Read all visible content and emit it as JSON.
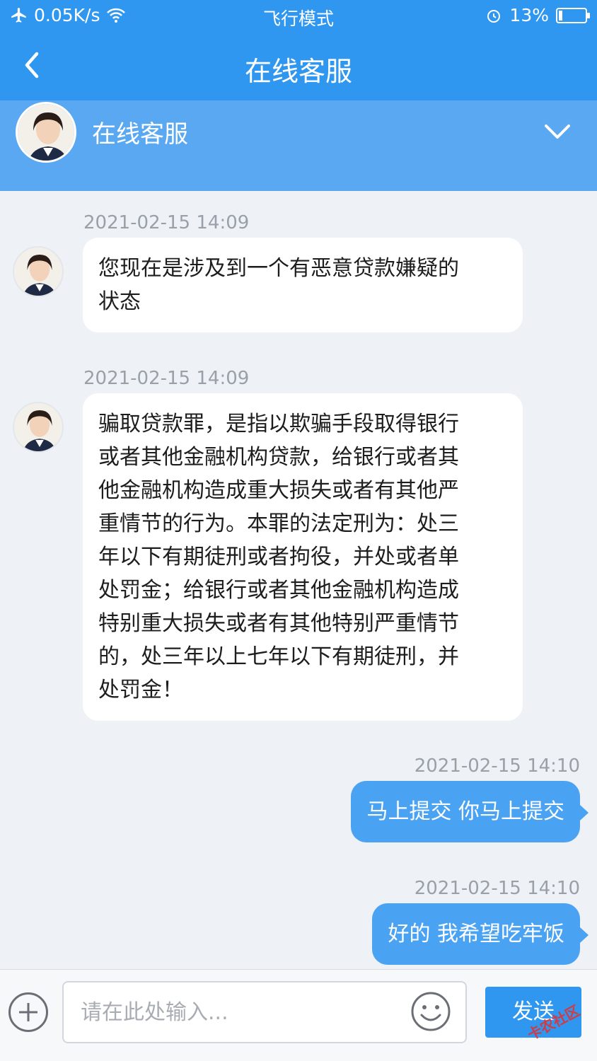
{
  "status_bar": {
    "speed": "0.05K/s",
    "mode": "飞行模式",
    "battery_text": "13%",
    "battery_level": 0.13,
    "icons": [
      "airplane-icon",
      "wifi-icon",
      "alarm-icon",
      "battery-charging-icon"
    ]
  },
  "nav": {
    "title": "在线客服",
    "back_icon": "chevron-left-icon"
  },
  "agent": {
    "name": "在线客服",
    "avatar_icon": "agent-avatar-icon",
    "expand_icon": "chevron-down-icon"
  },
  "messages": [
    {
      "side": "agent",
      "time": "2021-02-15 14:09",
      "lines": [
        "您现在是涉及到一个有恶意贷款嫌疑的",
        "状态"
      ]
    },
    {
      "side": "agent",
      "time": "2021-02-15 14:09",
      "lines": [
        "骗取贷款罪，是指以欺骗手段取得银行",
        "或者其他金融机构贷款，给银行或者其",
        "他金融机构造成重大损失或者有其他严",
        "重情节的行为。本罪的法定刑为：处三",
        "年以下有期徒刑或者拘役，并处或者单",
        "处罚金；给银行或者其他金融机构造成",
        "特别重大损失或者有其他特别严重情节",
        "的，处三年以上七年以下有期徒刑，并",
        "处罚金！"
      ]
    },
    {
      "side": "user",
      "time": "2021-02-15 14:10",
      "text": "马上提交 你马上提交"
    },
    {
      "side": "user",
      "time": "2021-02-15 14:10",
      "text": "好的 我希望吃牢饭"
    }
  ],
  "input": {
    "placeholder": "请在此处输入...",
    "send_label": "发送"
  },
  "watermark": "卡农社区"
}
